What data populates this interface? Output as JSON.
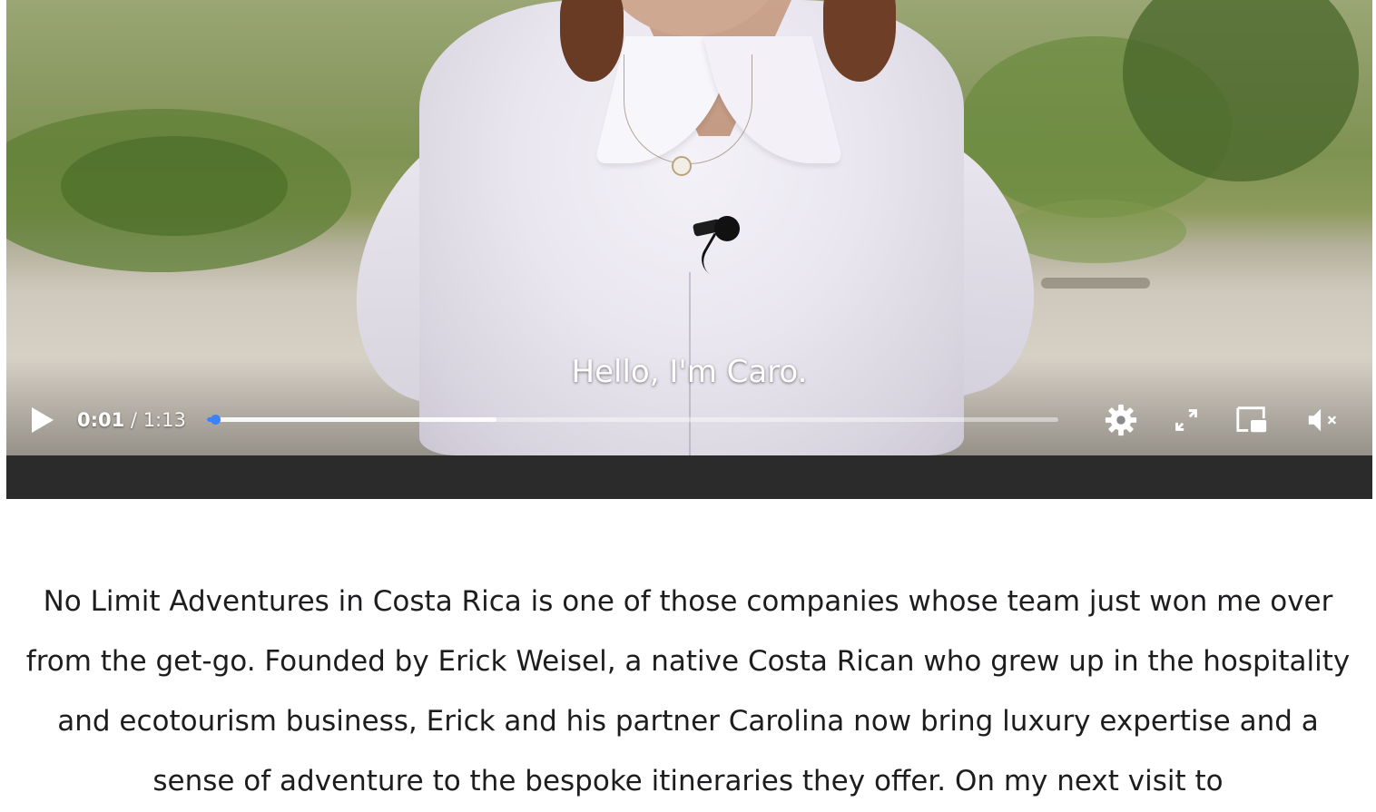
{
  "video": {
    "caption": "Hello, I'm Caro.",
    "current_time": "0:01",
    "separator": "/",
    "duration": "1:13",
    "progress_played_fraction": 0.01,
    "progress_buffered_fraction": 0.34,
    "accent_color": "#3b82f6",
    "icons": {
      "play": "play-icon",
      "settings": "gear-icon",
      "fullscreen": "expand-icon",
      "pip": "picture-in-picture-icon",
      "volume": "volume-muted-icon"
    }
  },
  "article": {
    "paragraph": "No Limit Adventures in Costa Rica is one of those companies whose team just won me over from the get-go. Founded by Erick Weisel, a native Costa Rican who grew up in the hospitality and ecotourism business, Erick and his partner Carolina now bring luxury expertise and a sense of adventure to the bespoke itineraries they offer. On my next visit to"
  }
}
